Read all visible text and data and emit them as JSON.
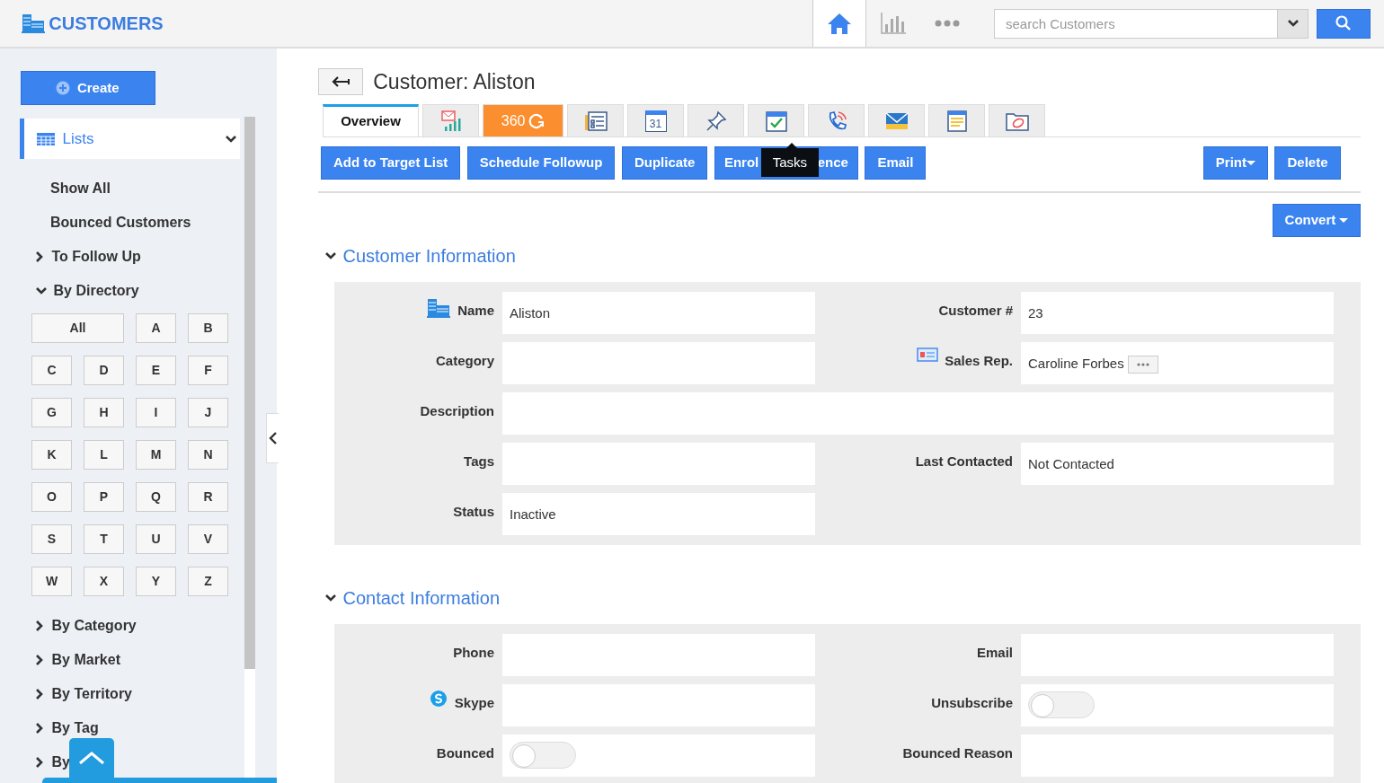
{
  "header": {
    "title": "CUSTOMERS",
    "nav": [
      {
        "kind": "home",
        "selected": true
      },
      {
        "kind": "chart",
        "selected": false
      },
      {
        "kind": "more",
        "selected": false
      }
    ],
    "search": {
      "placeholder": "search Customers"
    }
  },
  "sidebar": {
    "create_button": "Create",
    "lists": {
      "label": "Lists",
      "expanded": true
    },
    "items": [
      {
        "label": "Show All",
        "kind": "link"
      },
      {
        "label": "Bounced Customers",
        "kind": "link"
      },
      {
        "label": "To Follow Up",
        "kind": "group",
        "expanded": false
      },
      {
        "label": "By Directory",
        "kind": "group",
        "expanded": true,
        "letters": [
          "All",
          "A",
          "B",
          "C",
          "D",
          "E",
          "F",
          "G",
          "H",
          "I",
          "J",
          "K",
          "L",
          "M",
          "N",
          "O",
          "P",
          "Q",
          "R",
          "S",
          "T",
          "U",
          "V",
          "W",
          "X",
          "Y",
          "Z"
        ]
      },
      {
        "label": "By Category",
        "kind": "group",
        "expanded": false
      },
      {
        "label": "By Market",
        "kind": "group",
        "expanded": false
      },
      {
        "label": "By Territory",
        "kind": "group",
        "expanded": false
      },
      {
        "label": "By Tag",
        "kind": "group",
        "expanded": false
      },
      {
        "label": "By",
        "kind": "group",
        "expanded": false
      }
    ]
  },
  "page": {
    "title": "Customer: Aliston",
    "tabs": [
      {
        "kind": "text",
        "label": "Overview",
        "selected": true
      },
      {
        "kind": "icon",
        "selected": false
      },
      {
        "kind": "badge",
        "label": "360",
        "selected": false
      },
      {
        "kind": "icon",
        "selected": false
      },
      {
        "kind": "calendar",
        "label": "31",
        "selected": false
      },
      {
        "kind": "icon",
        "selected": false
      },
      {
        "kind": "icon",
        "selected": false
      },
      {
        "kind": "icon",
        "selected": false
      },
      {
        "kind": "icon",
        "selected": false
      },
      {
        "kind": "icon",
        "selected": false
      },
      {
        "kind": "icon",
        "selected": false
      }
    ],
    "actions": [
      {
        "label": "Add to Target List"
      },
      {
        "label": "Schedule Followup"
      },
      {
        "label": "Duplicate"
      },
      {
        "parts": [
          "Enrol",
          "ence"
        ]
      },
      {
        "label": "Email"
      }
    ],
    "tooltip": {
      "text": "Tasks"
    },
    "right_actions": [
      {
        "label": "Print",
        "dropdown": true
      },
      {
        "label": "Delete",
        "dropdown": false
      }
    ],
    "convert": {
      "label": "Convert",
      "dropdown": true
    },
    "sections": [
      {
        "title": "Customer Information",
        "expanded": true,
        "fields": [
          {
            "label": "Name",
            "kind": "text",
            "value": "Aliston"
          },
          {
            "label": "Customer #",
            "kind": "text",
            "value": "23"
          },
          {
            "label": "Category",
            "kind": "text"
          },
          {
            "label": "Sales Rep.",
            "kind": "lookup",
            "value": "Caroline Forbes"
          },
          {
            "label": "Description",
            "kind": "wide"
          },
          {
            "label": "Tags",
            "kind": "text"
          },
          {
            "label": "Last Contacted",
            "kind": "text",
            "value": "Not Contacted"
          },
          {
            "label": "Status",
            "kind": "text",
            "value": "Inactive"
          },
          {
            "kind": "empty"
          }
        ]
      },
      {
        "title": "Contact Information",
        "expanded": true,
        "fields": [
          {
            "label": "Phone",
            "kind": "text"
          },
          {
            "label": "Email",
            "kind": "text"
          },
          {
            "label": "Skype",
            "kind": "text"
          },
          {
            "label": "Unsubscribe",
            "kind": "toggle",
            "on": false
          },
          {
            "label": "Bounced",
            "kind": "toggle",
            "on": false
          },
          {
            "label": "Bounced Reason",
            "kind": "text"
          }
        ]
      }
    ]
  }
}
